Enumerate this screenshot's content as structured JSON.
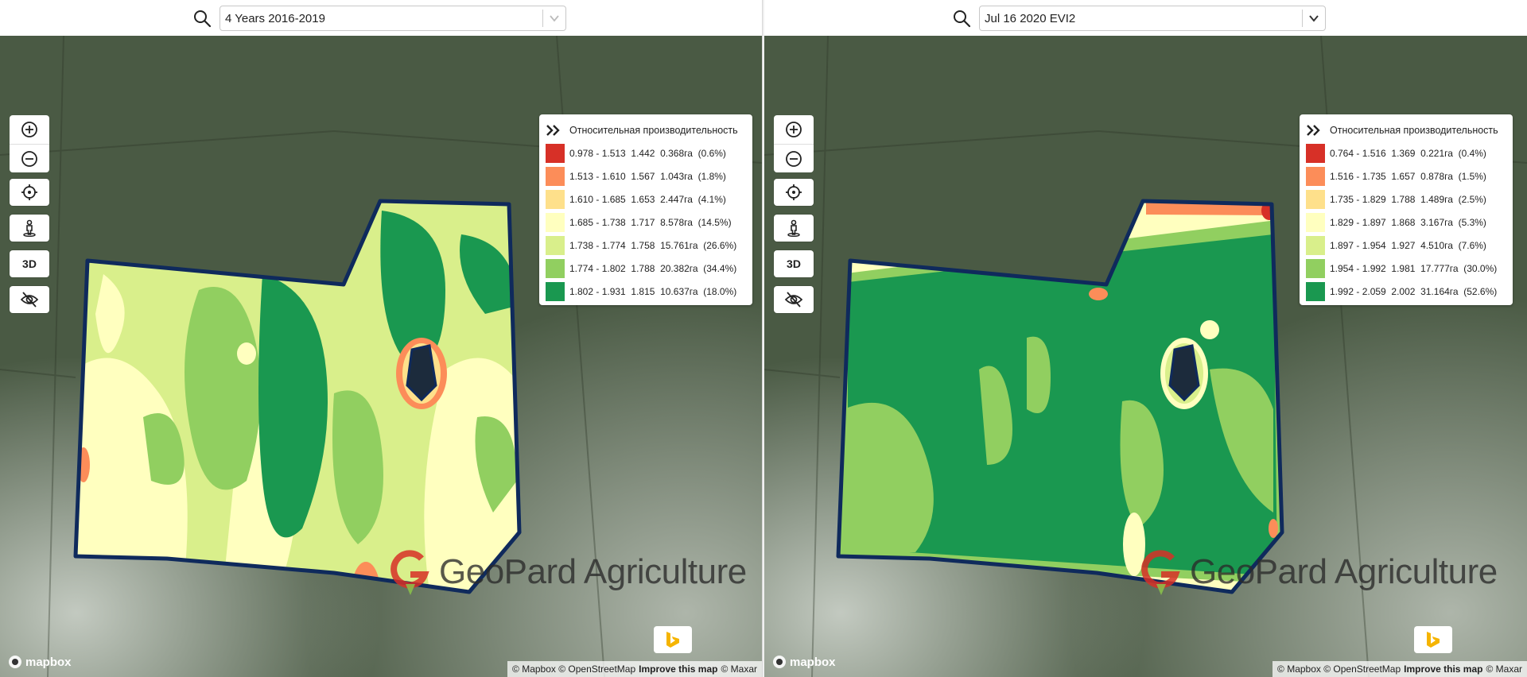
{
  "colors": {
    "red": "#d73027",
    "orange": "#fc8d59",
    "light_orange": "#fee08b",
    "pale_yellow": "#ffffbf",
    "light_green": "#d9ef8b",
    "mid_green": "#91cf60",
    "dark_green": "#1a9850",
    "boundary": "#0f2a5c"
  },
  "panels": [
    {
      "select_value": "4 Years 2016-2019",
      "legend": {
        "title": "Относительная производительность",
        "rows": [
          {
            "text": "0.978 - 1.513  1.442  0.368га  (0.6%)",
            "color": "#d73027"
          },
          {
            "text": "1.513 - 1.610  1.567  1.043га  (1.8%)",
            "color": "#fc8d59"
          },
          {
            "text": "1.610 - 1.685  1.653  2.447га  (4.1%)",
            "color": "#fee08b"
          },
          {
            "text": "1.685 - 1.738  1.717  8.578га  (14.5%)",
            "color": "#ffffbf"
          },
          {
            "text": "1.738 - 1.774  1.758  15.761га  (26.6%)",
            "color": "#d9ef8b"
          },
          {
            "text": "1.774 - 1.802  1.788  20.382га  (34.4%)",
            "color": "#91cf60"
          },
          {
            "text": "1.802 - 1.931  1.815  10.637га  (18.0%)",
            "color": "#1a9850"
          }
        ]
      },
      "watermark": "GeoPard Agriculture",
      "mapbox_label": "mapbox",
      "attribution": {
        "mapbox": "© Mapbox",
        "osm": "© OpenStreetMap",
        "improve": "Improve this map",
        "maxar": "© Maxar"
      }
    },
    {
      "select_value": "Jul 16 2020 EVI2",
      "legend": {
        "title": "Относительная производительность",
        "rows": [
          {
            "text": "0.764 - 1.516  1.369  0.221га  (0.4%)",
            "color": "#d73027"
          },
          {
            "text": "1.516 - 1.735  1.657  0.878га  (1.5%)",
            "color": "#fc8d59"
          },
          {
            "text": "1.735 - 1.829  1.788  1.489га  (2.5%)",
            "color": "#fee08b"
          },
          {
            "text": "1.829 - 1.897  1.868  3.167га  (5.3%)",
            "color": "#ffffbf"
          },
          {
            "text": "1.897 - 1.954  1.927  4.510га  (7.6%)",
            "color": "#d9ef8b"
          },
          {
            "text": "1.954 - 1.992  1.981  17.777га  (30.0%)",
            "color": "#91cf60"
          },
          {
            "text": "1.992 - 2.059  2.002  31.164га  (52.6%)",
            "color": "#1a9850"
          }
        ]
      },
      "watermark": "GeoPard Agriculture",
      "mapbox_label": "mapbox",
      "attribution": {
        "mapbox": "© Mapbox",
        "osm": "© OpenStreetMap",
        "improve": "Improve this map",
        "maxar": "© Maxar"
      }
    }
  ],
  "controls": {
    "three_d_label": "3D"
  },
  "icons": [
    "search-icon",
    "chevron-down-icon",
    "zoom-in-icon",
    "zoom-out-icon",
    "locate-icon",
    "street-view-icon",
    "eye-off-icon",
    "expand-chevrons-icon",
    "geopard-logo",
    "mapbox-logo",
    "bing-logo"
  ]
}
